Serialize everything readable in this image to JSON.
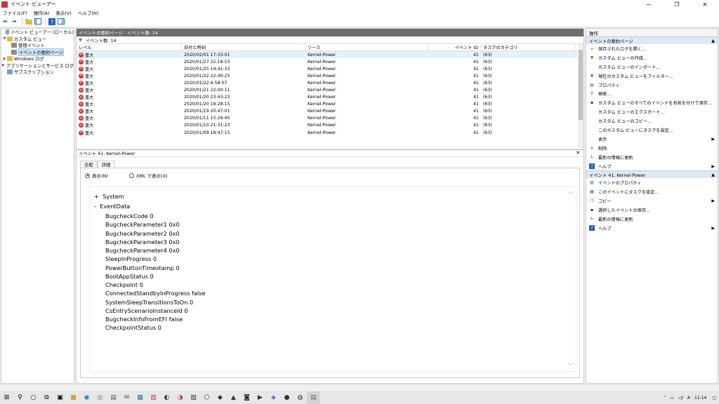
{
  "window": {
    "title": "イベント ビューアー",
    "minimize": "—",
    "maximize": "❐",
    "close": "✕"
  },
  "menu": [
    "ファイル(F)",
    "操作(A)",
    "表示(V)",
    "ヘルプ(H)"
  ],
  "tree": {
    "root": "イベント ビューアー (ローカル)",
    "custom_views": "カスタム ビュー",
    "admin_events": "管理イベント",
    "summary_page": "イベントの要約ページ",
    "windows_logs": "Windows ログ",
    "app_service_logs": "アプリケーションとサービス ログ",
    "subscriptions": "サブスクリプション"
  },
  "center": {
    "header": "イベントの要約ページ　イベント数: 14",
    "filter": "イベント数: 14",
    "columns": [
      "レベル",
      "日付と時刻",
      "ソース",
      "イベント ID",
      "タスクのカテゴリ"
    ],
    "rows": [
      {
        "level": "重大",
        "date": "2020/02/01 17:33:01",
        "source": "Kernel-Power",
        "id": "41",
        "cat": "(63)"
      },
      {
        "level": "重大",
        "date": "2020/01/27 22:18:53",
        "source": "Kernel-Power",
        "id": "41",
        "cat": "(63)"
      },
      {
        "level": "重大",
        "date": "2020/01/25 14:41:33",
        "source": "Kernel-Power",
        "id": "41",
        "cat": "(63)"
      },
      {
        "level": "重大",
        "date": "2020/01/22 22:40:25",
        "source": "Kernel-Power",
        "id": "41",
        "cat": "(63)"
      },
      {
        "level": "重大",
        "date": "2020/01/22 6:58:07",
        "source": "Kernel-Power",
        "id": "41",
        "cat": "(63)"
      },
      {
        "level": "重大",
        "date": "2020/01/21 22:00:11",
        "source": "Kernel-Power",
        "id": "41",
        "cat": "(63)"
      },
      {
        "level": "重大",
        "date": "2020/01/20 23:43:23",
        "source": "Kernel-Power",
        "id": "41",
        "cat": "(63)"
      },
      {
        "level": "重大",
        "date": "2020/01/20 18:28:15",
        "source": "Kernel-Power",
        "id": "41",
        "cat": "(63)"
      },
      {
        "level": "重大",
        "date": "2020/01/19 20:47:01",
        "source": "Kernel-Power",
        "id": "41",
        "cat": "(63)"
      },
      {
        "level": "重大",
        "date": "2020/01/11 15:29:45",
        "source": "Kernel-Power",
        "id": "41",
        "cat": "(63)"
      },
      {
        "level": "重大",
        "date": "2020/01/10 21:31:23",
        "source": "Kernel-Power",
        "id": "41",
        "cat": "(63)"
      },
      {
        "level": "重大",
        "date": "2020/01/09 18:47:15",
        "source": "Kernel-Power",
        "id": "41",
        "cat": "(63)"
      }
    ]
  },
  "detail": {
    "title": "イベント 41, Kernel-Power",
    "close": "✕",
    "tabs": [
      "全般",
      "詳細"
    ],
    "radio_friendly": "表示(N)",
    "radio_xml": "XML で表示(X)",
    "system_toggle": "+",
    "system": "System",
    "eventdata_toggle": "-",
    "eventdata": "EventData",
    "fields": [
      {
        "k": "BugcheckCode",
        "v": "0"
      },
      {
        "k": "BugcheckParameter1",
        "v": "0x0"
      },
      {
        "k": "BugcheckParameter2",
        "v": "0x0"
      },
      {
        "k": "BugcheckParameter3",
        "v": "0x0"
      },
      {
        "k": "BugcheckParameter4",
        "v": "0x0"
      },
      {
        "k": "SleepInProgress",
        "v": "0"
      },
      {
        "k": "PowerButtonTimestamp",
        "v": "0"
      },
      {
        "k": "BootAppStatus",
        "v": "0"
      },
      {
        "k": "Checkpoint",
        "v": "0"
      },
      {
        "k": "ConnectedStandbyInProgress",
        "v": "false"
      },
      {
        "k": "SystemSleepTransitionsToOn",
        "v": "0"
      },
      {
        "k": "CsEntryScenarioInstanceId",
        "v": "0"
      },
      {
        "k": "BugcheckInfoFromEFI",
        "v": "false"
      },
      {
        "k": "CheckpointStatus",
        "v": "0"
      }
    ]
  },
  "actions": {
    "header": "操作",
    "section1": "イベントの要約ページ",
    "items1": [
      {
        "icon": "open-folder-icon",
        "label": "保存されたログを開く..."
      },
      {
        "icon": "filter-icon",
        "label": "カスタム ビューの作成..."
      },
      {
        "icon": "blank-icon",
        "label": "カスタム ビューのインポート..."
      },
      {
        "icon": "filter-icon",
        "label": "現在のカスタム ビューをフィルター..."
      },
      {
        "icon": "properties-icon",
        "label": "プロパティ"
      },
      {
        "icon": "find-icon",
        "label": "検索..."
      },
      {
        "icon": "save-icon",
        "label": "カスタム ビューのすべてのイベントを名前を付けて保存..."
      },
      {
        "icon": "blank-icon",
        "label": "カスタム ビューのエクスポート..."
      },
      {
        "icon": "blank-icon",
        "label": "カスタム ビューのコピー..."
      },
      {
        "icon": "blank-icon",
        "label": "このカスタム ビューにタスクを設定..."
      },
      {
        "icon": "blank-icon",
        "label": "表示",
        "submenu": true
      },
      {
        "icon": "delete-icon",
        "label": "削除"
      },
      {
        "icon": "refresh-icon",
        "label": "最新の情報に更新"
      },
      {
        "icon": "help-icon",
        "label": "ヘルプ",
        "submenu": true
      }
    ],
    "section2": "イベント 41, Kernel-Power",
    "items2": [
      {
        "icon": "properties-icon",
        "label": "イベントのプロパティ"
      },
      {
        "icon": "task-icon",
        "label": "このイベントにタスクを設定..."
      },
      {
        "icon": "copy-icon",
        "label": "コピー",
        "submenu": true
      },
      {
        "icon": "save-icon",
        "label": "選択したイベントの保存..."
      },
      {
        "icon": "refresh-icon",
        "label": "最新の情報に更新"
      },
      {
        "icon": "help-icon",
        "label": "ヘルプ",
        "submenu": true
      }
    ]
  },
  "tray": {
    "time": "11:14"
  }
}
